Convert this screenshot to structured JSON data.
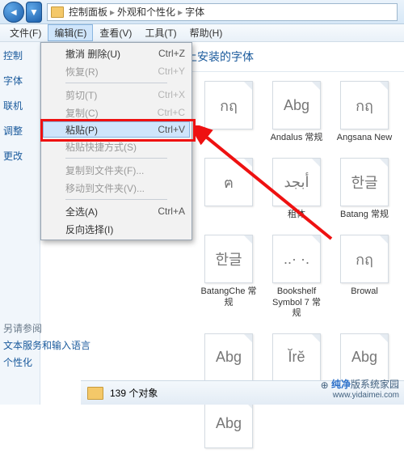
{
  "titlebar": {
    "back_icon": "◄",
    "fwd_icon": "▼",
    "path": [
      "控制面板",
      "外观和个性化",
      "字体"
    ]
  },
  "menubar": {
    "items": [
      {
        "label": "文件(F)"
      },
      {
        "label": "编辑(E)",
        "active": true
      },
      {
        "label": "查看(V)"
      },
      {
        "label": "工具(T)"
      },
      {
        "label": "帮助(H)"
      }
    ]
  },
  "sidebar": {
    "items": [
      "控制",
      "字体",
      "联机",
      "调整",
      "更改"
    ],
    "bottom_heading": "另请参阅",
    "bottom_items": [
      "文本服务和输入语言",
      "个性化"
    ]
  },
  "heading": "删除或者显示和隐藏计算机上安装的字体",
  "dropdown": {
    "rows": [
      {
        "label": "撤消 删除(U)",
        "shortcut": "Ctrl+Z"
      },
      {
        "label": "恢复(R)",
        "shortcut": "Ctrl+Y",
        "disabled": true
      },
      {
        "sep": true
      },
      {
        "label": "剪切(T)",
        "shortcut": "Ctrl+X",
        "disabled": true
      },
      {
        "label": "复制(C)",
        "shortcut": "Ctrl+C",
        "disabled": true
      },
      {
        "label": "粘贴(P)",
        "shortcut": "Ctrl+V",
        "hl": true
      },
      {
        "label": "粘贴快捷方式(S)",
        "disabled": true
      },
      {
        "sep": true
      },
      {
        "label": "复制到文件夹(F)...",
        "disabled": true
      },
      {
        "label": "移动到文件夹(V)...",
        "disabled": true
      },
      {
        "sep": true
      },
      {
        "label": "全选(A)",
        "shortcut": "Ctrl+A"
      },
      {
        "label": "反向选择(I)"
      }
    ]
  },
  "fonts": [
    {
      "preview": "กฤ",
      "name": "",
      "truncated": true
    },
    {
      "preview": "Abg",
      "name": "Andalus 常规"
    },
    {
      "preview": "กฤ",
      "name": "Angsana New"
    },
    {
      "preview": "ฅ",
      "name": ""
    },
    {
      "preview": "أبجد",
      "name": "租体",
      "truncated": true
    },
    {
      "preview": "한글",
      "name": "Batang 常规"
    },
    {
      "preview": "한글",
      "name": "BatangChe 常规"
    },
    {
      "preview": "..· ·.",
      "name": "Bookshelf Symbol 7 常规"
    },
    {
      "preview": "กฤ",
      "name": "Browal"
    },
    {
      "preview": "Abg",
      "name": ""
    },
    {
      "preview": "Ĭrĕ",
      "name": ""
    },
    {
      "preview": "Abg",
      "name": ""
    },
    {
      "preview": "Abg",
      "name": ""
    }
  ],
  "status": {
    "count": "139 个对象"
  },
  "watermark": {
    "brand": "纯净",
    "rest": "版系统家园",
    "url": "www.yidaimei.com"
  }
}
